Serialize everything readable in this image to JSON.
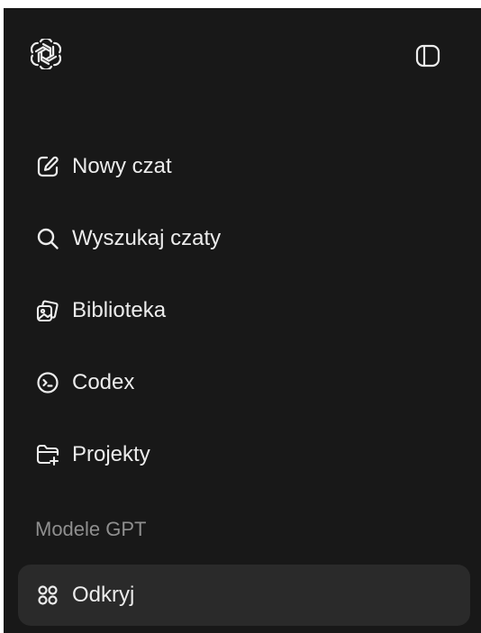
{
  "header": {
    "logo_icon": "openai-logo-icon",
    "sidebar_toggle_icon": "sidebar-toggle-icon"
  },
  "nav": {
    "items": [
      {
        "label": "Nowy czat",
        "icon": "edit-icon"
      },
      {
        "label": "Wyszukaj czaty",
        "icon": "search-icon"
      },
      {
        "label": "Biblioteka",
        "icon": "library-icon"
      },
      {
        "label": "Codex",
        "icon": "terminal-icon"
      },
      {
        "label": "Projekty",
        "icon": "folder-plus-icon"
      }
    ]
  },
  "gpts": {
    "section_title": "Modele GPT",
    "discover_label": "Odkryj",
    "discover_icon": "grid-icon"
  },
  "colors": {
    "sidebar_bg": "#181818",
    "text": "#ececec",
    "muted_text": "#8f8f8f",
    "active_bg": "#2a2a2a"
  }
}
